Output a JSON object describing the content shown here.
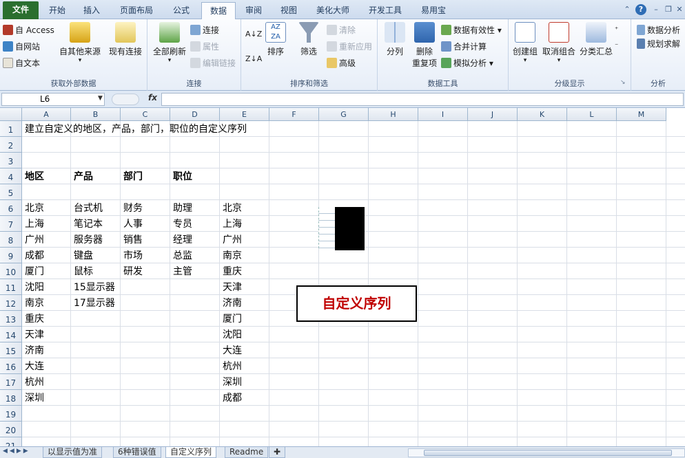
{
  "tabs": [
    "文件",
    "开始",
    "插入",
    "页面布局",
    "公式",
    "数据",
    "审阅",
    "视图",
    "美化大师",
    "开发工具",
    "易用宝"
  ],
  "active_tab": "数据",
  "ribbon": {
    "get_external": {
      "access": "自 Access",
      "web": "自网站",
      "text": "自文本",
      "other_sources": "自其他来源",
      "existing": "现有连接",
      "label": "获取外部数据"
    },
    "connections": {
      "refresh_all": "全部刷新",
      "connections": "连接",
      "properties": "属性",
      "edit_links": "编辑链接",
      "label": "连接"
    },
    "sort_filter": {
      "sort": "排序",
      "filter": "筛选",
      "clear": "清除",
      "reapply": "重新应用",
      "advanced": "高级",
      "label": "排序和筛选"
    },
    "data_tools": {
      "text_to_columns": "分列",
      "remove_dup_line1": "删除",
      "remove_dup_line2": "重复项",
      "validation": "数据有效性",
      "consolidate": "合并计算",
      "what_if": "模拟分析",
      "label": "数据工具"
    },
    "outline": {
      "group": "创建组",
      "ungroup": "取消组合",
      "subtotal": "分类汇总",
      "label": "分级显示"
    },
    "analysis": {
      "data_analysis": "数据分析",
      "solver": "规划求解",
      "label": "分析"
    }
  },
  "formula_bar": {
    "name_box": "L6",
    "fx": "fx",
    "content": ""
  },
  "columns": [
    "A",
    "B",
    "C",
    "D",
    "E",
    "F",
    "G",
    "H",
    "I",
    "J",
    "K",
    "L",
    "M"
  ],
  "rows": [
    "1",
    "2",
    "3",
    "4",
    "5",
    "6",
    "7",
    "8",
    "9",
    "10",
    "11",
    "12",
    "13",
    "14",
    "15",
    "16",
    "17",
    "18",
    "19",
    "20",
    "21"
  ],
  "cells": {
    "A1": "建立自定义的地区，产品，部门，职位的自定义序列",
    "A4": "地区",
    "B4": "产品",
    "C4": "部门",
    "D4": "职位",
    "A6": "北京",
    "B6": "台式机",
    "C6": "财务",
    "D6": "助理",
    "E6": "北京",
    "A7": "上海",
    "B7": "笔记本",
    "C7": "人事",
    "D7": "专员",
    "E7": "上海",
    "A8": "广州",
    "B8": "服务器",
    "C8": "销售",
    "D8": "经理",
    "E8": "广州",
    "A9": "成都",
    "B9": "键盘",
    "C9": "市场",
    "D9": "总监",
    "E9": "南京",
    "A10": "厦门",
    "B10": "鼠标",
    "C10": "研发",
    "D10": "主管",
    "E10": "重庆",
    "A11": "沈阳",
    "B11": "15显示器",
    "E11": "天津",
    "A12": "南京",
    "B12": "17显示器",
    "E12": "济南",
    "A13": "重庆",
    "E13": "厦门",
    "A14": "天津",
    "E14": "沈阳",
    "A15": "济南",
    "E15": "大连",
    "A16": "大连",
    "E16": "杭州",
    "A17": "杭州",
    "E17": "深圳",
    "A18": "深圳",
    "E18": "成都"
  },
  "callout": {
    "text": "自定义序列",
    "color": "#c00000"
  },
  "sheet_tabs": [
    "以显示值为准",
    "6种错误值",
    "自定义序列",
    "Readme"
  ],
  "active_sheet": "自定义序列",
  "colors": {
    "file_tab": "#2a6f2f",
    "header_bg": "#dfe6ef",
    "grid_line": "#d9dee6"
  }
}
